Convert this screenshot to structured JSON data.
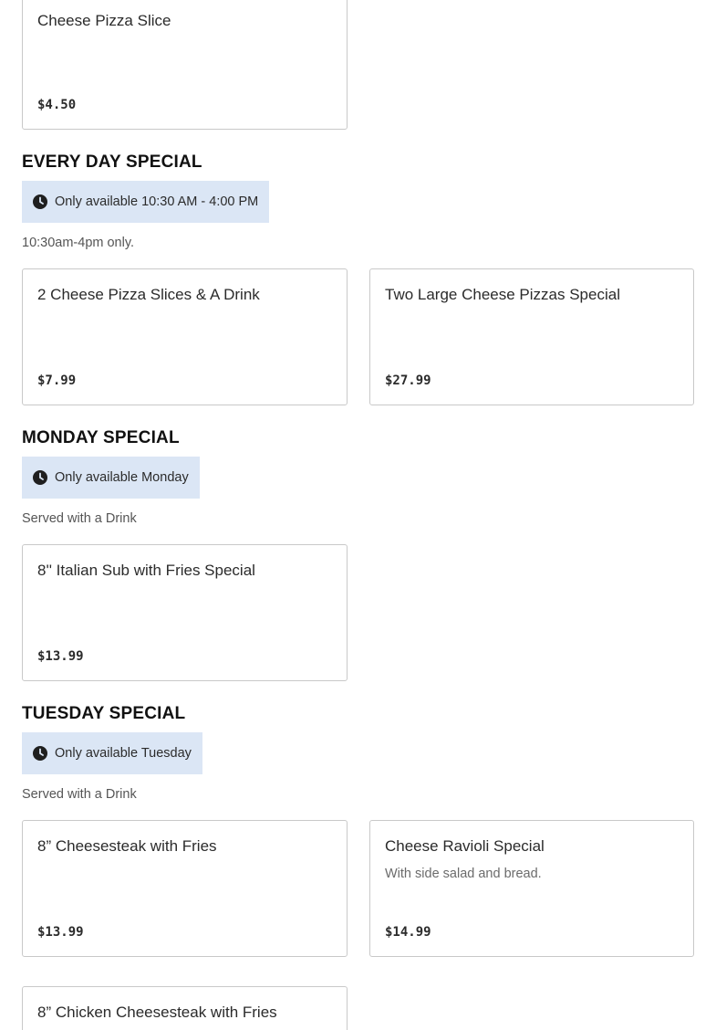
{
  "top_item": {
    "name": "Cheese Pizza Slice",
    "price": "$4.50"
  },
  "sections": [
    {
      "title": "EVERY DAY SPECIAL",
      "availability": "Only available 10:30 AM - 4:00 PM",
      "note": "10:30am-4pm only.",
      "items": [
        {
          "name": "2 Cheese Pizza Slices & A Drink",
          "price": "$7.99"
        },
        {
          "name": "Two Large Cheese Pizzas Special",
          "price": "$27.99"
        }
      ]
    },
    {
      "title": "MONDAY SPECIAL",
      "availability": "Only available Monday",
      "note": "Served with a Drink",
      "items": [
        {
          "name": "8'' Italian Sub with Fries Special",
          "price": "$13.99"
        }
      ]
    },
    {
      "title": "TUESDAY SPECIAL",
      "availability": "Only available Tuesday",
      "note": "Served with a Drink",
      "items": [
        {
          "name": "8” Cheesesteak with Fries",
          "price": "$13.99"
        },
        {
          "name": "Cheese Ravioli Special",
          "description": "With side salad and bread.",
          "price": "$14.99"
        },
        {
          "name": "8” Chicken Cheesesteak with Fries"
        }
      ]
    }
  ],
  "icons": {
    "availability": "clock-icon"
  },
  "colors": {
    "availability_bg": "#dbe6f5",
    "card_border": "#c9c9c9"
  }
}
